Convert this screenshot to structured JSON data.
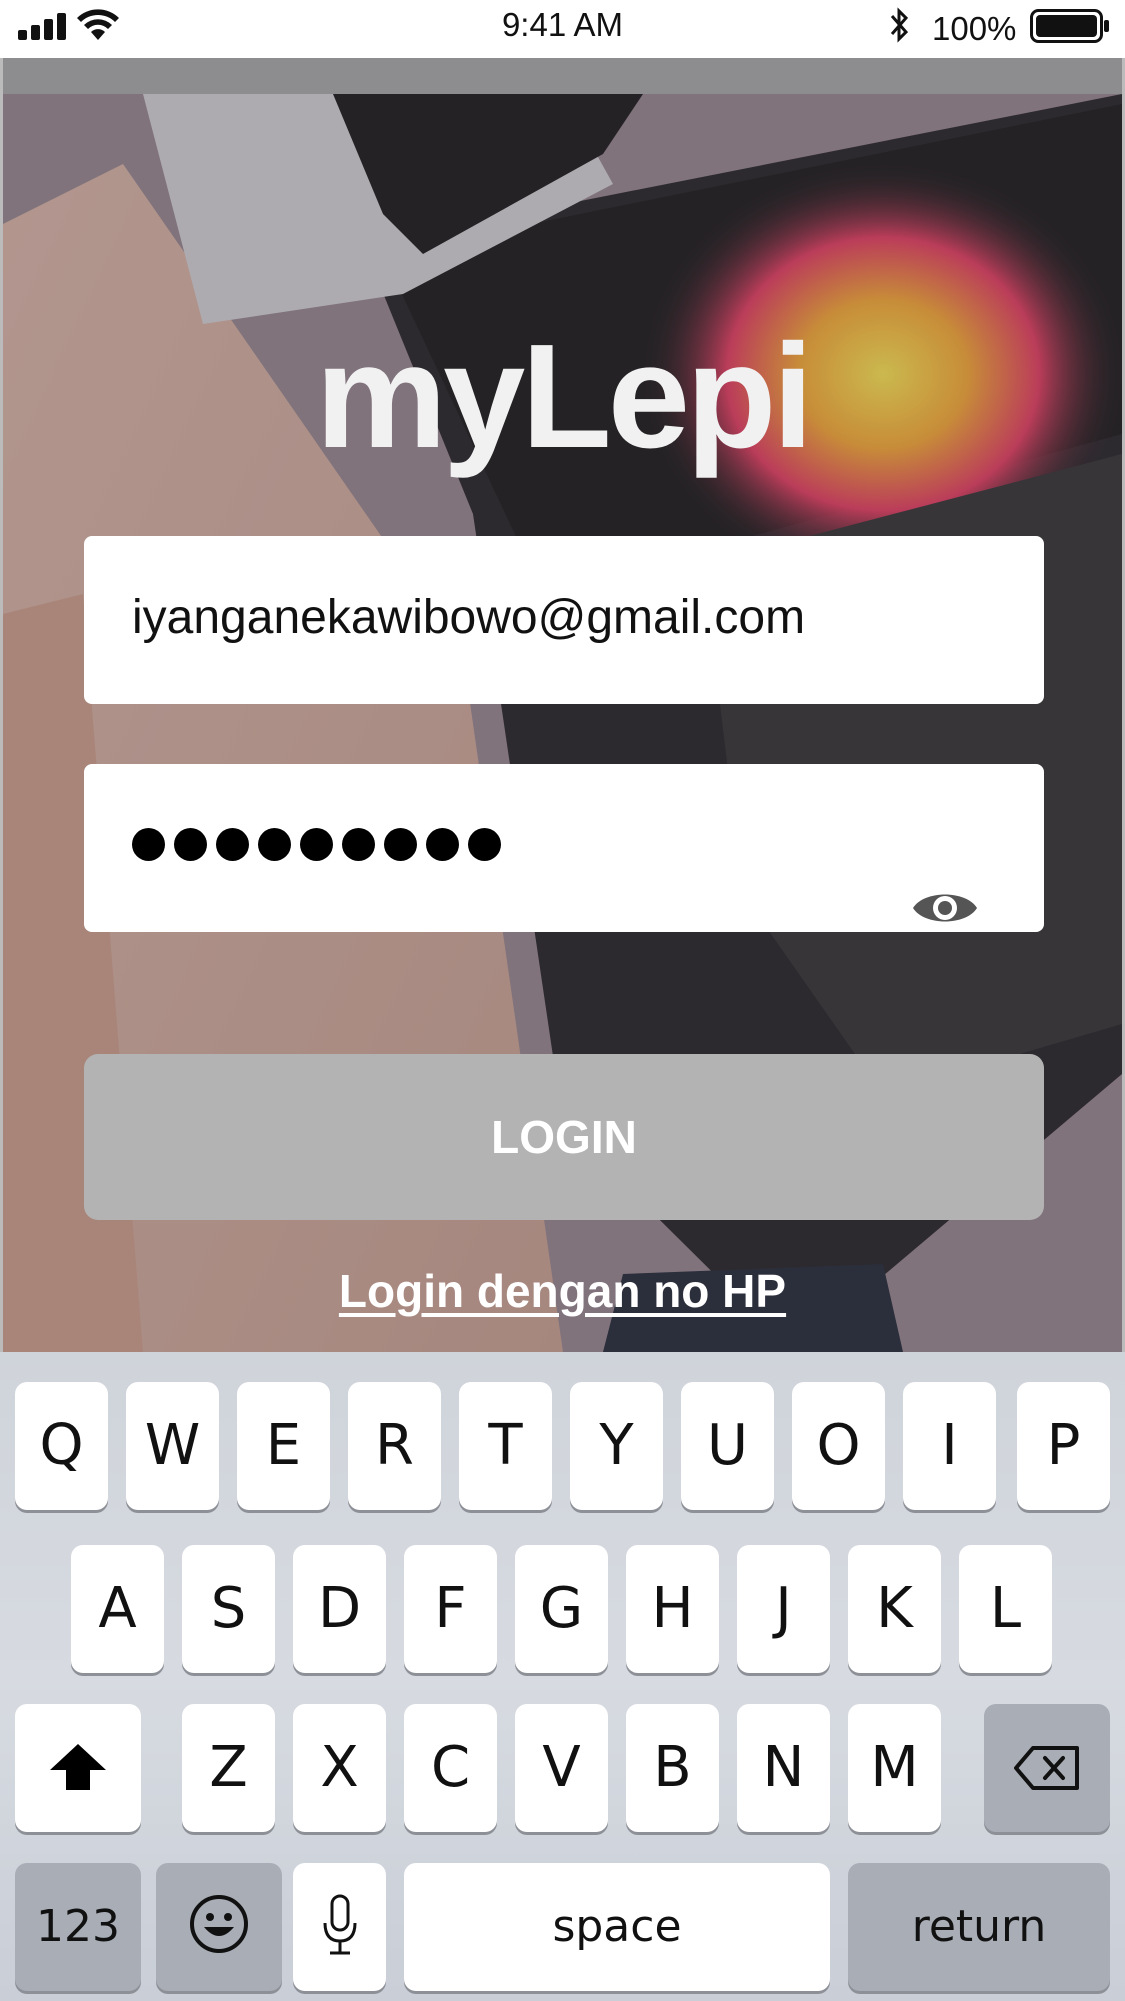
{
  "status_bar": {
    "time": "9:41 AM",
    "battery": "100%",
    "icons": [
      "signal-icon",
      "wifi-icon",
      "bluetooth-icon",
      "battery-icon"
    ]
  },
  "app": {
    "title": "myLepi"
  },
  "login_form": {
    "email_value": "iyanganekawibowo@gmail.com",
    "password_masked_length": 9,
    "login_label": "LOGIN",
    "alt_login_label": "Login dengan no HP"
  },
  "keyboard": {
    "row1": [
      "Q",
      "W",
      "E",
      "R",
      "T",
      "Y",
      "U",
      "O",
      "I",
      "P"
    ],
    "row2": [
      "A",
      "S",
      "D",
      "F",
      "G",
      "H",
      "J",
      "K",
      "L"
    ],
    "row3": [
      "Z",
      "X",
      "C",
      "V",
      "B",
      "N",
      "M"
    ],
    "numbers_label": "123",
    "space_label": "space",
    "return_label": "return"
  },
  "colors": {
    "login_button": "#b3b3b3",
    "title": "#f1f1f1",
    "keyboard_bg": "#d1d5dc"
  }
}
